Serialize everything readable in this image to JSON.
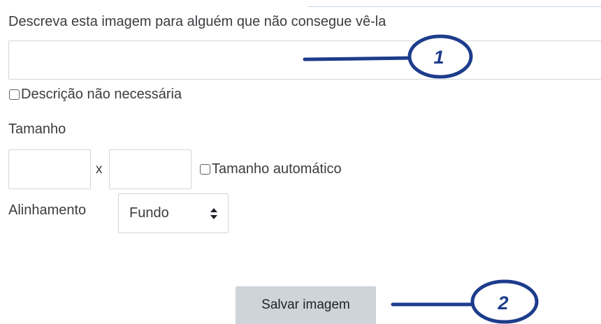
{
  "form": {
    "description_label": "Descreva esta imagem para alguém que não consegue vê-la",
    "description_value": "",
    "no_description_label": "Descrição não necessária",
    "size_label": "Tamanho",
    "width_value": "",
    "size_separator": "x",
    "height_value": "",
    "auto_size_label": "Tamanho automático",
    "alignment_label": "Alinhamento",
    "alignment_value": "Fundo",
    "save_label": "Salvar imagem"
  },
  "annotations": {
    "marker_1": "1",
    "marker_2": "2",
    "color": "#1d3c8c"
  },
  "colors": {
    "text": "#3a3d40",
    "border": "#d2d6da",
    "button_bg": "#ced4da"
  }
}
